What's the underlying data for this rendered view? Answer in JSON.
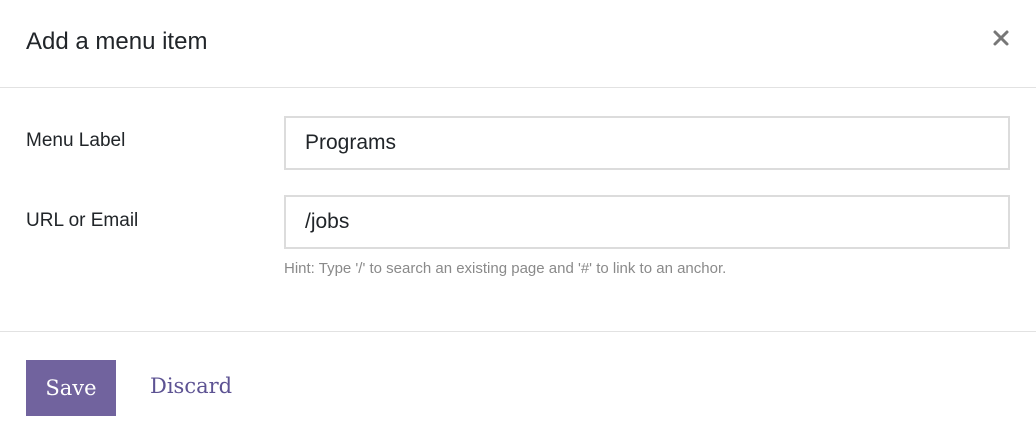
{
  "dialog": {
    "title": "Add a menu item",
    "close_icon": "close-icon"
  },
  "form": {
    "menu_label": {
      "label": "Menu Label",
      "value": "Programs"
    },
    "url": {
      "label": "URL or Email",
      "value": "/jobs"
    },
    "hint": "Hint: Type '/' to search an existing page and '#' to link to an anchor."
  },
  "footer": {
    "save_label": "Save",
    "discard_label": "Discard"
  },
  "colors": {
    "primary": "#71639e",
    "link": "#5d5393",
    "hint": "#8a8a8a",
    "border": "#dcdcdc"
  }
}
